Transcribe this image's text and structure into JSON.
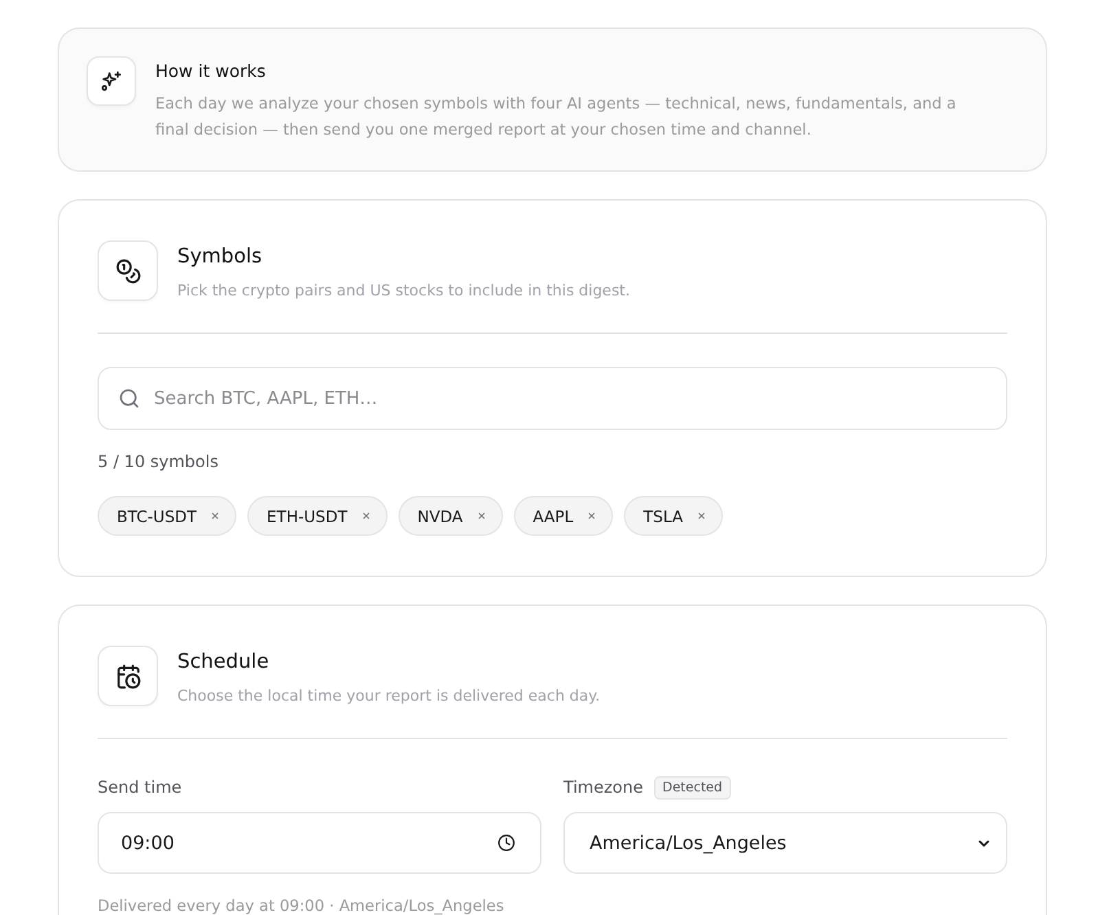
{
  "info": {
    "title": "How it works",
    "text": "Each day we analyze your chosen symbols with four AI agents — technical, news, fundamentals, and a final decision — then send you one merged report at your chosen time and channel."
  },
  "symbols": {
    "title": "Symbols",
    "subtitle": "Pick the crypto pairs and US stocks to include in this digest.",
    "search": {
      "placeholder": "Search BTC, AAPL, ETH…"
    },
    "count": "5 / 10 symbols",
    "chips": [
      "BTC-USDT",
      "ETH-USDT",
      "NVDA",
      "AAPL",
      "TSLA"
    ]
  },
  "schedule": {
    "title": "Schedule",
    "subtitle": "Choose the local time your report is delivered each day.",
    "send_time": {
      "label": "Send time",
      "value": "09:00"
    },
    "timezone": {
      "label": "Timezone",
      "badge": "Detected",
      "value": "America/Los_Angeles"
    },
    "note": "Delivered every day at 09:00 · America/Los_Angeles"
  }
}
